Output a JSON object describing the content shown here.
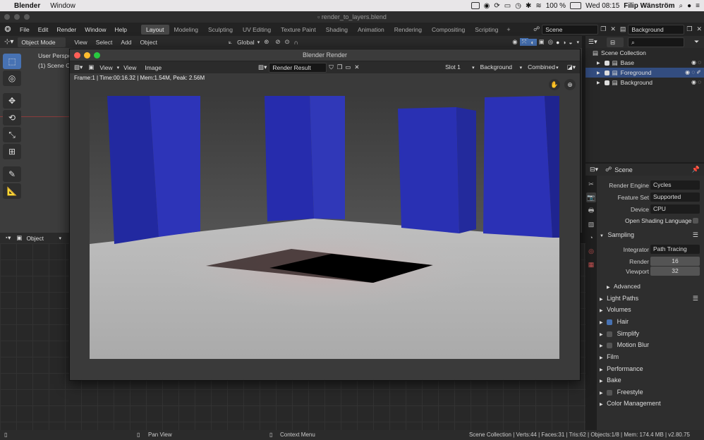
{
  "mac": {
    "app": "Blender",
    "menu": [
      "Window"
    ],
    "battery": "100 %",
    "clock": "Wed 08:15",
    "user": "Filip Wänström"
  },
  "window": {
    "filename": "render_to_layers.blend"
  },
  "topmenu": [
    "File",
    "Edit",
    "Render",
    "Window",
    "Help"
  ],
  "workspaces": [
    "Layout",
    "Modeling",
    "Sculpting",
    "UV Editing",
    "Texture Paint",
    "Shading",
    "Animation",
    "Rendering",
    "Compositing",
    "Scripting"
  ],
  "active_workspace": "Layout",
  "scene_field": "Scene",
  "layer_field": "Background",
  "viewport": {
    "mode": "Object Mode",
    "menus": [
      "View",
      "Select",
      "Add",
      "Object"
    ],
    "orientation": "Global",
    "overlay_line1": "User Perspe",
    "overlay_line2": "(1) Scene C"
  },
  "lower": {
    "mode": "Object"
  },
  "render_window": {
    "title": "Blender Render",
    "menus": [
      "View",
      "View",
      "Image"
    ],
    "image_name": "Render Result",
    "slot": "Slot 1",
    "layer": "Background",
    "pass": "Combined",
    "info": "Frame:1 | Time:00:16.32 | Mem:1.54M, Peak: 2.56M"
  },
  "outliner": {
    "root": "Scene Collection",
    "items": [
      {
        "name": "Base",
        "selected": false
      },
      {
        "name": "Foreground",
        "selected": true
      },
      {
        "name": "Background",
        "selected": false
      }
    ]
  },
  "properties": {
    "header": "Scene",
    "render_engine_label": "Render Engine",
    "render_engine": "Cycles",
    "feature_set_label": "Feature Set",
    "feature_set": "Supported",
    "device_label": "Device",
    "device": "CPU",
    "osl_label": "Open Shading Language",
    "sampling": "Sampling",
    "integrator_label": "Integrator",
    "integrator": "Path Tracing",
    "render_label": "Render",
    "render_samples": "16",
    "viewport_label": "Viewport",
    "viewport_samples": "32",
    "advanced": "Advanced",
    "panels": [
      "Light Paths",
      "Volumes",
      "Hair",
      "Simplify",
      "Motion Blur",
      "Film",
      "Performance",
      "Bake",
      "Freestyle",
      "Color Management"
    ]
  },
  "status": {
    "left": "Pan View",
    "middle": "Context Menu",
    "right": "Scene Collection | Verts:44 | Faces:31 | Tris:62 | Objects:1/8 | Mem: 174.4 MB | v2.80.75"
  }
}
